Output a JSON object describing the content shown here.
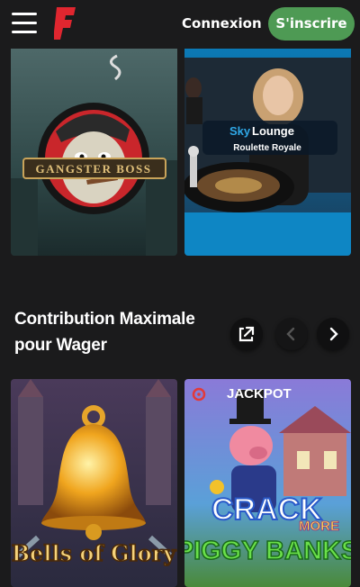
{
  "header": {
    "login_label": "Connexion",
    "signup_label": "S'inscrire",
    "colors": {
      "signup_bg": "#4e9a54",
      "logo": "#e0262f"
    }
  },
  "top_games": [
    {
      "title": "GANGSTER BOSS"
    },
    {
      "brand_sky": "Sky",
      "brand_lounge": "Lounge",
      "subtitle": "Roulette Royale"
    }
  ],
  "section": {
    "title": "Contribution Maximale pour Wager",
    "icons": [
      "external-link-icon",
      "chevron-left-icon",
      "chevron-right-icon"
    ]
  },
  "bottom_games": [
    {
      "title": "Bells of Glory"
    },
    {
      "badge": "JACKPOT",
      "title_line1": "CRACK",
      "title_more": "MORE",
      "title_line2": "PIGGY BANKS"
    }
  ]
}
